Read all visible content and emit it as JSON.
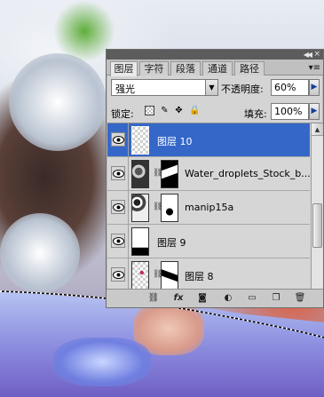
{
  "panel": {
    "tabs": [
      {
        "label": "图层",
        "active": true
      },
      {
        "label": "字符",
        "active": false
      },
      {
        "label": "段落",
        "active": false
      },
      {
        "label": "通道",
        "active": false
      },
      {
        "label": "路径",
        "active": false
      }
    ],
    "blend_mode": "强光",
    "opacity_label": "不透明度:",
    "opacity_value": "60%",
    "lock_label": "锁定:",
    "fill_label": "填充:",
    "fill_value": "100%",
    "layers": [
      {
        "name": "图层 10",
        "selected": true,
        "has_mask": false
      },
      {
        "name": "Water_droplets_Stock_b...",
        "selected": false,
        "has_mask": true
      },
      {
        "name": "manip15a",
        "selected": false,
        "has_mask": true
      },
      {
        "name": "图层 9",
        "selected": false,
        "has_mask": false
      },
      {
        "name": "图层 8",
        "selected": false,
        "has_mask": true
      }
    ],
    "selection_color": "#3567c8"
  }
}
